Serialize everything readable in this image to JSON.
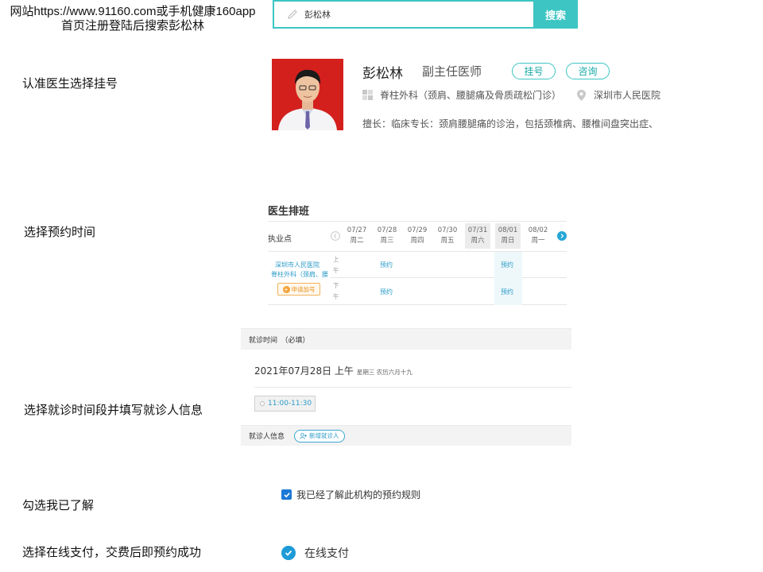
{
  "steps": {
    "intro": "网站https://www.91160.com或手机健康160app首页注册登陆后搜索彭松林",
    "step1": "认准医生选择挂号",
    "step2": "选择预约时间",
    "step3": "选择就诊时间段并填写就诊人信息",
    "step4": "勾选我已了解",
    "step5": "选择在线支付，交费后即预约成功"
  },
  "search": {
    "value": "彭松林",
    "button_label": "搜索"
  },
  "doctor": {
    "name": "彭松林",
    "title": "副主任医师",
    "register_label": "挂号",
    "consult_label": "咨询",
    "department": "脊柱外科（颈肩、腰腿痛及骨质疏松门诊）",
    "hospital": "深圳市人民医院",
    "specialty": "擅长：临床专长：颈肩腰腿痛的诊治，包括颈椎病、腰椎间盘突出症、"
  },
  "schedule": {
    "title": "医生排班",
    "column_label": "执业点",
    "days": [
      {
        "date": "07/27",
        "weekday": "周二"
      },
      {
        "date": "07/28",
        "weekday": "周三"
      },
      {
        "date": "07/29",
        "weekday": "周四"
      },
      {
        "date": "07/30",
        "weekday": "周五"
      },
      {
        "date": "07/31",
        "weekday": "周六"
      },
      {
        "date": "08/01",
        "weekday": "周日"
      },
      {
        "date": "08/02",
        "weekday": "周一"
      }
    ],
    "hospital_link": "深圳市人民医院",
    "department_link": "脊柱外科（颈肩、腰",
    "apply_label": "申请加号",
    "morning": "上午",
    "afternoon": "下午",
    "slot_label": "预约"
  },
  "visit": {
    "header": "就诊时间　（必填）",
    "date_text": "2021年07月28日 上午",
    "date_detail": "星期三 农历六月十九",
    "time_slot": "11:00-11:30"
  },
  "patient": {
    "header": "就诊人信息",
    "add_label": "新增就诊人"
  },
  "agreement": {
    "label": "我已经了解此机构的预约规则",
    "checked": true
  },
  "payment": {
    "label": "在线支付",
    "selected": true
  },
  "colors": {
    "accent": "#3cc5c3",
    "link": "#2a9bc7",
    "checkbox": "#1b79d6"
  }
}
